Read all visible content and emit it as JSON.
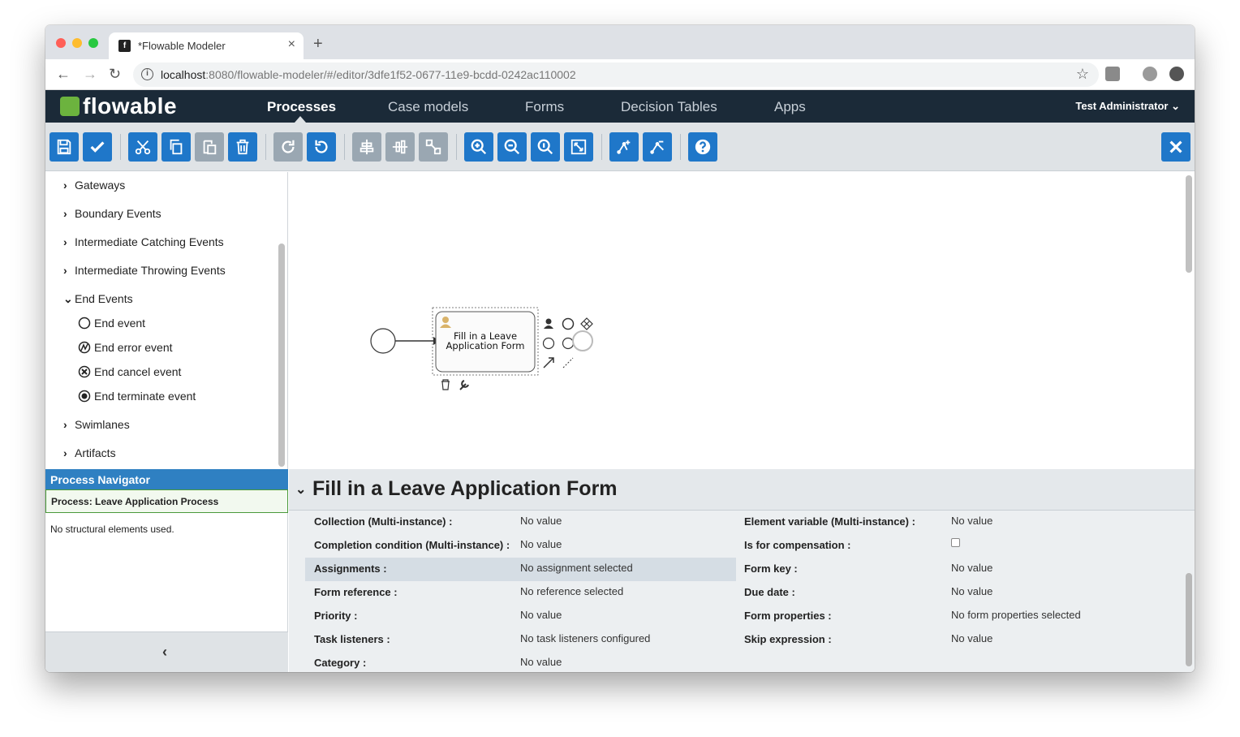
{
  "browser": {
    "tab_title": "*Flowable Modeler",
    "url_host": "localhost",
    "url_rest": ":8080/flowable-modeler/#/editor/3dfe1f52-0677-11e9-bcdd-0242ac110002"
  },
  "app": {
    "logo_text": "flowable",
    "nav": [
      "Processes",
      "Case models",
      "Forms",
      "Decision Tables",
      "Apps"
    ],
    "active_nav": "Processes",
    "user": "Test Administrator"
  },
  "palette": {
    "groups": [
      {
        "label": "Gateways",
        "expanded": false
      },
      {
        "label": "Boundary Events",
        "expanded": false
      },
      {
        "label": "Intermediate Catching Events",
        "expanded": false
      },
      {
        "label": "Intermediate Throwing Events",
        "expanded": false
      },
      {
        "label": "End Events",
        "expanded": true
      },
      {
        "label": "Swimlanes",
        "expanded": false
      },
      {
        "label": "Artifacts",
        "expanded": false
      }
    ],
    "end_events": [
      "End event",
      "End error event",
      "End cancel event",
      "End terminate event"
    ]
  },
  "navigator": {
    "title": "Process Navigator",
    "process": "Process: Leave Application Process",
    "empty": "No structural elements used."
  },
  "canvas": {
    "task_label_line1": "Fill in a Leave",
    "task_label_line2": "Application Form"
  },
  "properties": {
    "title": "Fill in a Leave Application Form",
    "left": [
      {
        "label": "Collection (Multi-instance) :",
        "value": "No value"
      },
      {
        "label": "Completion condition (Multi-instance) :",
        "value": "No value"
      },
      {
        "label": "Assignments :",
        "value": "No assignment selected"
      },
      {
        "label": "Form reference :",
        "value": "No reference selected"
      },
      {
        "label": "Priority :",
        "value": "No value"
      },
      {
        "label": "Task listeners :",
        "value": "No task listeners configured"
      },
      {
        "label": "Category :",
        "value": "No value"
      }
    ],
    "right": [
      {
        "label": "Element variable (Multi-instance) :",
        "value": "No value"
      },
      {
        "label": "Is for compensation :",
        "value": ""
      },
      {
        "label": "Form key :",
        "value": "No value"
      },
      {
        "label": "Due date :",
        "value": "No value"
      },
      {
        "label": "Form properties :",
        "value": "No form properties selected"
      },
      {
        "label": "Skip expression :",
        "value": "No value"
      }
    ]
  },
  "colors": {
    "accent": "#1f77c9",
    "header": "#1b2a38",
    "brand_green": "#6cb33e"
  }
}
